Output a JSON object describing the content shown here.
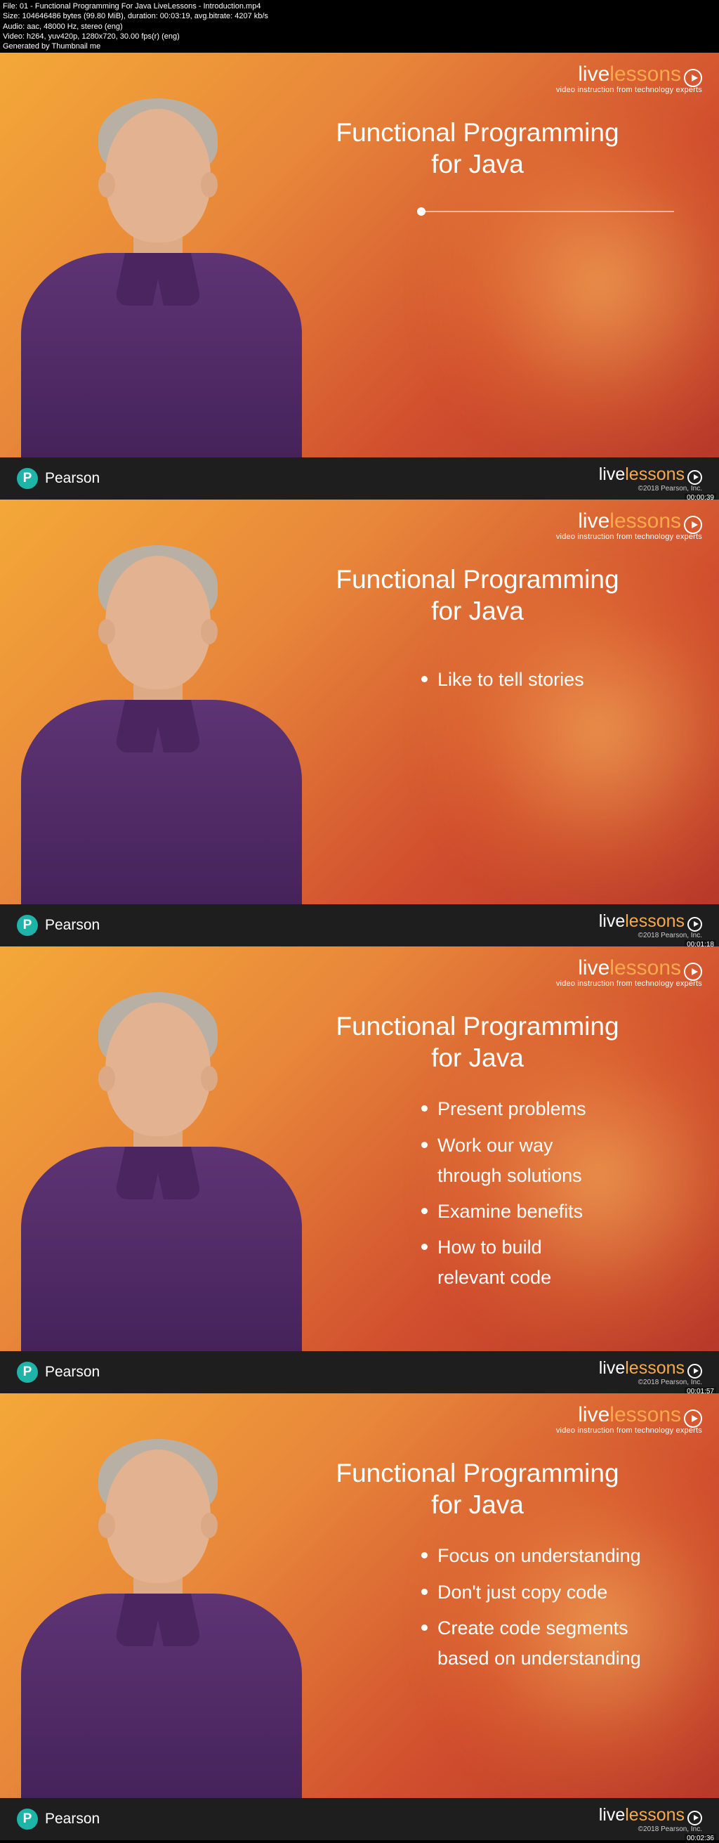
{
  "metadata": {
    "file": "File: 01 - Functional Programming For Java LiveLessons - Introduction.mp4",
    "size": "Size: 104646486 bytes (99.80 MiB), duration: 00:03:19, avg.bitrate: 4207 kb/s",
    "audio": "Audio: aac, 48000 Hz, stereo (eng)",
    "video": "Video: h264, yuv420p, 1280x720, 30.00 fps(r) (eng)",
    "generated": "Generated by Thumbnail me"
  },
  "logo": {
    "live": "live",
    "lessons": "lessons",
    "tagline": "video instruction from technology experts"
  },
  "course": {
    "title_line1": "Functional Programming",
    "title_line2": "for Java"
  },
  "footer": {
    "pearson": "Pearson",
    "pearson_p": "P",
    "copyright": "©2018 Pearson, Inc."
  },
  "frames": [
    {
      "timestamp": "00:00:39",
      "bullets": []
    },
    {
      "timestamp": "00:01:18",
      "bullets": [
        "Like to tell stories"
      ]
    },
    {
      "timestamp": "00:01:57",
      "bullets": [
        "Present problems",
        "Work our way through solutions",
        "Examine benefits",
        "How to build relevant code"
      ]
    },
    {
      "timestamp": "00:02:36",
      "bullets": [
        "Focus on understanding",
        "Don't just copy code",
        "Create code segments based on understanding"
      ]
    }
  ]
}
